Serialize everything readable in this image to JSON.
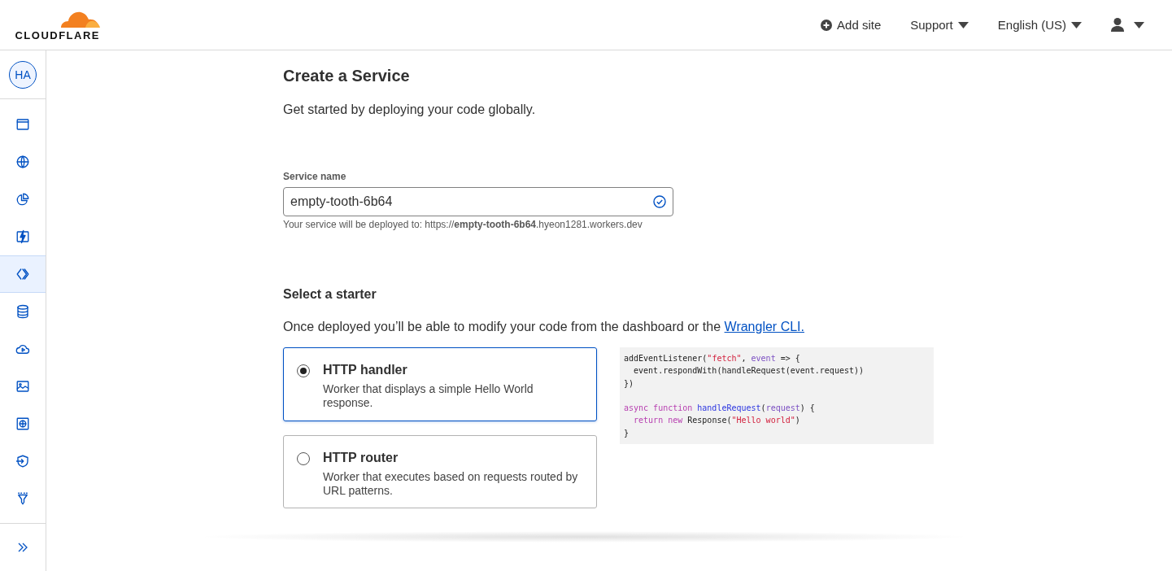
{
  "brand": {
    "wordmark": "CLOUDFLARE"
  },
  "header": {
    "add_site": "Add site",
    "support": "Support",
    "language": "English (US)"
  },
  "sidebar": {
    "avatar": "HA",
    "items": [
      {
        "selected": false
      },
      {
        "selected": false
      },
      {
        "selected": false
      },
      {
        "selected": false
      },
      {
        "selected": true
      },
      {
        "selected": false
      },
      {
        "selected": false
      },
      {
        "selected": false
      },
      {
        "selected": false
      },
      {
        "selected": false
      },
      {
        "selected": false
      }
    ]
  },
  "page": {
    "title": "Create a Service",
    "subtitle": "Get started by deploying your code globally."
  },
  "service_name": {
    "label": "Service name",
    "value": "empty-tooth-6b64",
    "valid": true,
    "hint": "Your service will be deployed to: https://**empty-tooth-6b64**.hyeon1281.workers.dev"
  },
  "starter": {
    "heading": "Select a starter",
    "intro": "Once deployed you’ll be able to modify your code from the dashboard or the",
    "link": "Wrangler CLI.",
    "options": [
      {
        "title": "HTTP handler",
        "description": "Worker that displays a simple Hello World response.",
        "selected": true
      },
      {
        "title": "HTTP router",
        "description": "Worker that executes based on requests routed by URL patterns.",
        "selected": false
      }
    ],
    "code": [
      {
        "kind": "code",
        "tokens": [
          {
            "text": "addEventListener(",
            "kind": "plain"
          },
          {
            "text": "\"fetch\"",
            "kind": "string"
          },
          {
            "text": ", ",
            "kind": "plain"
          },
          {
            "text": "event",
            "kind": "param"
          },
          {
            "text": " => {",
            "kind": "plain"
          }
        ]
      },
      {
        "kind": "code",
        "tokens": [
          {
            "text": "  event.respondWith(handleRequest(event.request))",
            "kind": "plain"
          }
        ]
      },
      {
        "kind": "code",
        "tokens": [
          {
            "text": "})",
            "kind": "plain"
          }
        ]
      },
      {
        "kind": "blank"
      },
      {
        "kind": "code",
        "tokens": [
          {
            "text": "async function ",
            "kind": "keyword"
          },
          {
            "text": "handleRequest",
            "kind": "func"
          },
          {
            "text": "(",
            "kind": "plain"
          },
          {
            "text": "request",
            "kind": "param"
          },
          {
            "text": ") {",
            "kind": "plain"
          }
        ]
      },
      {
        "kind": "code",
        "tokens": [
          {
            "text": "  return new ",
            "kind": "keyword"
          },
          {
            "text": "Response(",
            "kind": "plain"
          },
          {
            "text": "\"Hello world\"",
            "kind": "string"
          },
          {
            "text": ")",
            "kind": "plain"
          }
        ]
      },
      {
        "kind": "code",
        "tokens": [
          {
            "text": "}",
            "kind": "plain"
          }
        ]
      }
    ]
  }
}
